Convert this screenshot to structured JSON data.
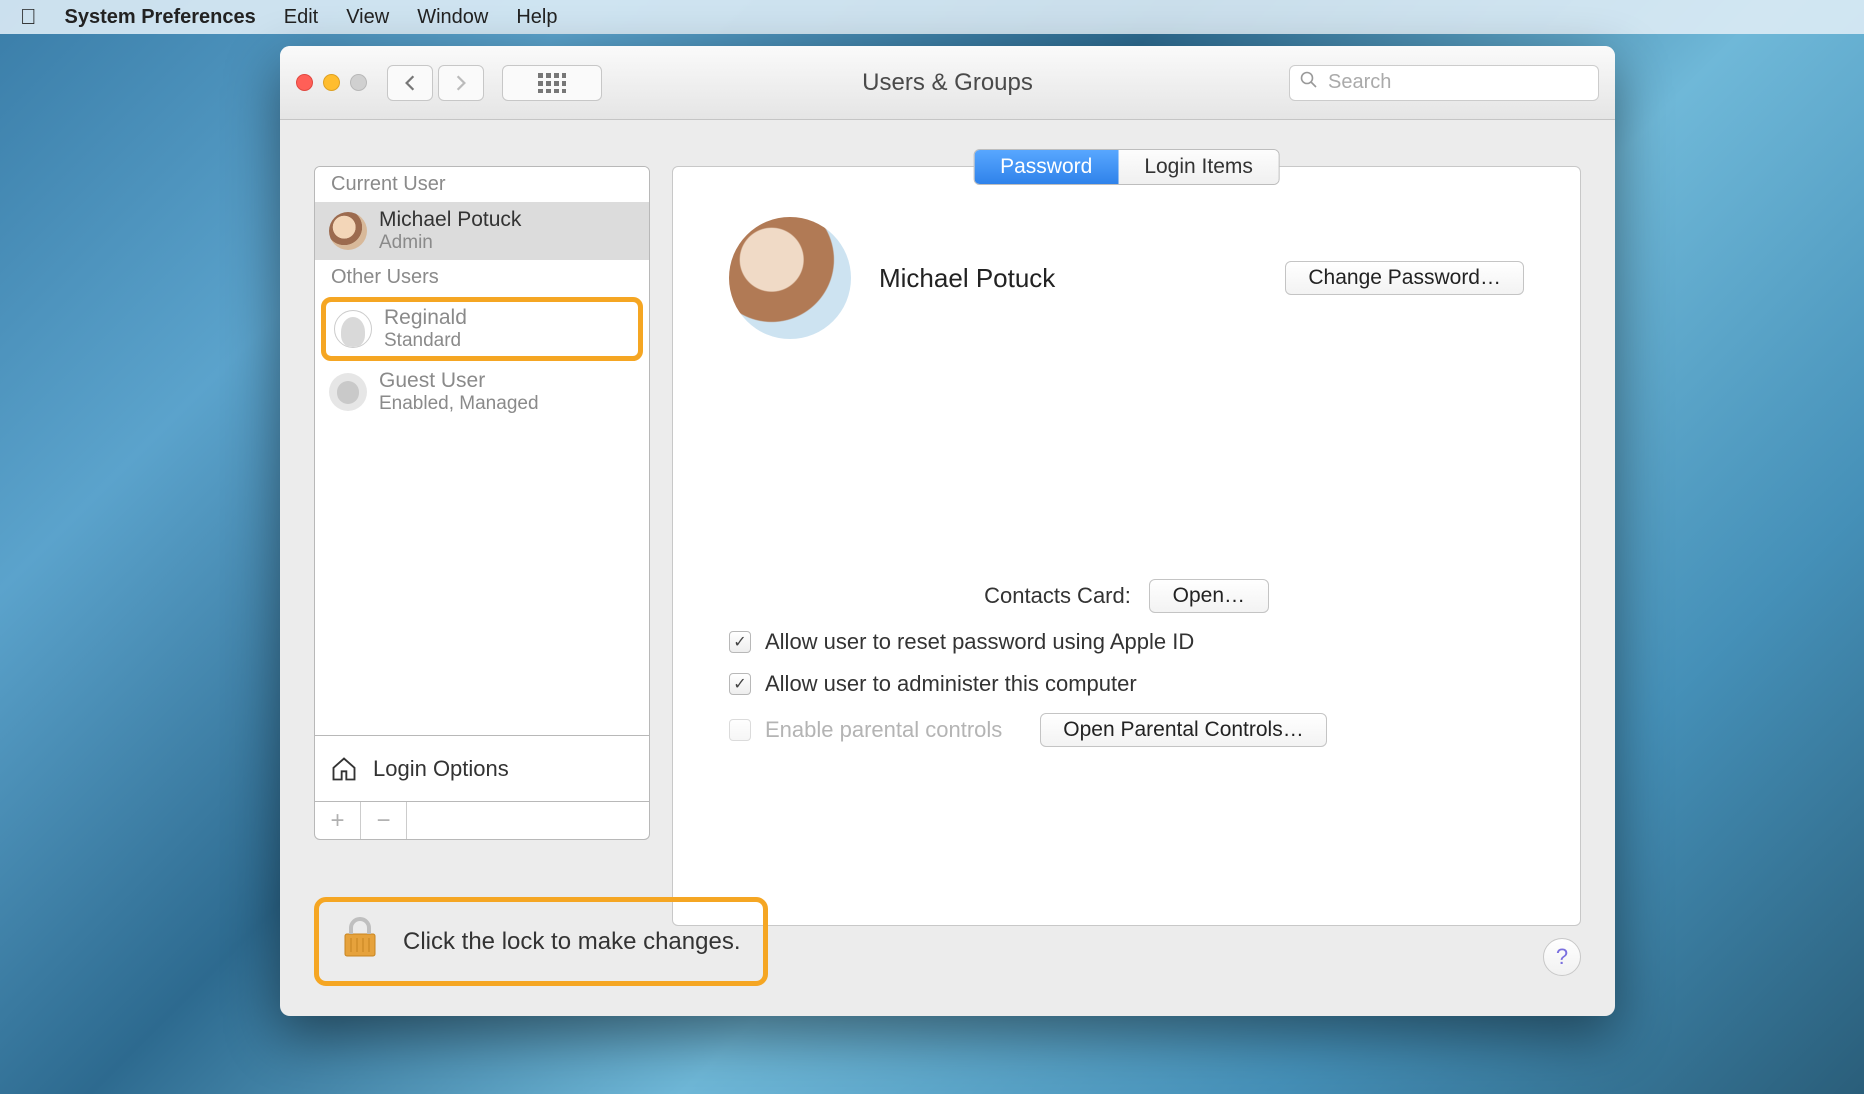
{
  "menubar": {
    "app": "System Preferences",
    "items": [
      "Edit",
      "View",
      "Window",
      "Help"
    ]
  },
  "window": {
    "title": "Users & Groups",
    "search_placeholder": "Search"
  },
  "sidebar": {
    "current_label": "Current User",
    "other_label": "Other Users",
    "current_user": {
      "name": "Michael Potuck",
      "role": "Admin"
    },
    "other_users": [
      {
        "name": "Reginald",
        "role": "Standard",
        "highlighted": true
      },
      {
        "name": "Guest User",
        "role": "Enabled, Managed"
      }
    ],
    "login_options": "Login Options"
  },
  "main": {
    "tabs": {
      "password": "Password",
      "login_items": "Login Items",
      "active": "password"
    },
    "user_name": "Michael Potuck",
    "change_password_btn": "Change Password…",
    "contacts_label": "Contacts Card:",
    "open_btn": "Open…",
    "allow_reset": "Allow user to reset password using Apple ID",
    "allow_admin": "Allow user to administer this computer",
    "enable_parental": "Enable parental controls",
    "open_parental_btn": "Open Parental Controls…",
    "allow_reset_checked": true,
    "allow_admin_checked": true,
    "enable_parental_checked": false
  },
  "lock": {
    "message": "Click the lock to make changes."
  }
}
